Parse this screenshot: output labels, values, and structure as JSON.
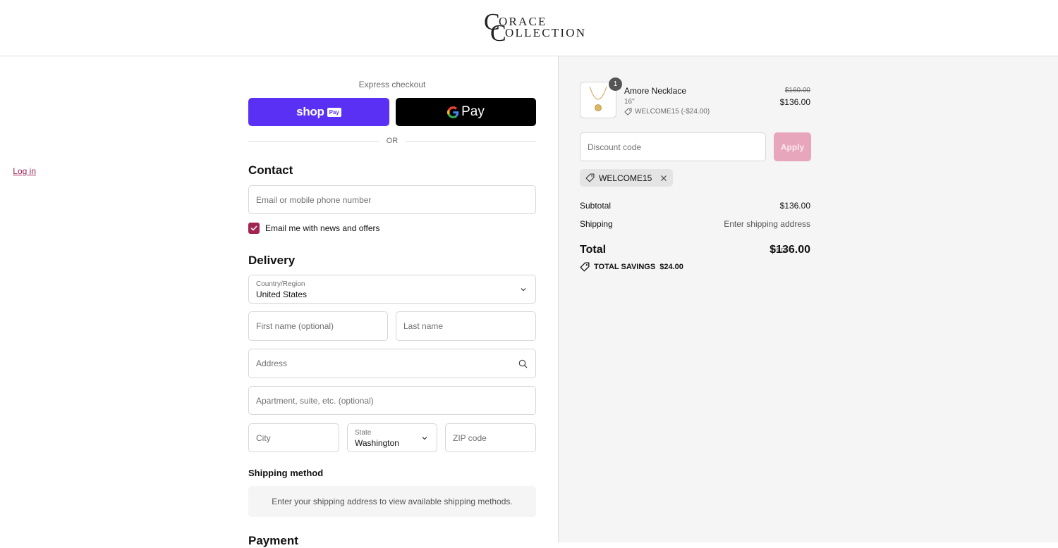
{
  "header": {
    "logo": {
      "line1_big": "C",
      "line1_small": "ORACE",
      "line2_big": "C",
      "line2_small": "OLLECTION"
    }
  },
  "express": {
    "title": "Express checkout",
    "shop_pay": {
      "word": "shop",
      "badge": "Pay"
    },
    "gpay": {
      "word": "Pay"
    },
    "or": "OR"
  },
  "contact": {
    "title": "Contact",
    "login": "Log in",
    "email_placeholder": "Email or mobile phone number",
    "newsletter_label": "Email me with news and offers",
    "newsletter_checked": true
  },
  "delivery": {
    "title": "Delivery",
    "country_label": "Country/Region",
    "country_value": "United States",
    "first_name_placeholder": "First name (optional)",
    "last_name_placeholder": "Last name",
    "address_placeholder": "Address",
    "apartment_placeholder": "Apartment, suite, etc. (optional)",
    "city_placeholder": "City",
    "state_label": "State",
    "state_value": "Washington",
    "zip_placeholder": "ZIP code"
  },
  "shipping_method": {
    "title": "Shipping method",
    "note": "Enter your shipping address to view available shipping methods."
  },
  "payment": {
    "title": "Payment"
  },
  "summary": {
    "item": {
      "quantity": "1",
      "name": "Amore Necklace",
      "variant": "16\"",
      "discount": "WELCOME15 (-$24.00)",
      "original_price": "$160.00",
      "price": "$136.00"
    },
    "discount_placeholder": "Discount code",
    "apply_label": "Apply",
    "applied_code": "WELCOME15",
    "subtotal_label": "Subtotal",
    "subtotal_value": "$136.00",
    "shipping_label": "Shipping",
    "shipping_value": "Enter shipping address",
    "total_label": "Total",
    "total_currency": "USD",
    "total_value": "$136.00",
    "savings_label": "TOTAL SAVINGS",
    "savings_value": "$24.00"
  },
  "colors": {
    "accent": "#a12451",
    "shop_pay": "#5a31f4",
    "apply_disabled": "#e8a6bd",
    "summary_bg": "#f5f5f5"
  },
  "icons": [
    "chevron-down-icon",
    "search-icon",
    "tag-icon",
    "close-icon",
    "checkmark-icon",
    "google-g-icon"
  ]
}
